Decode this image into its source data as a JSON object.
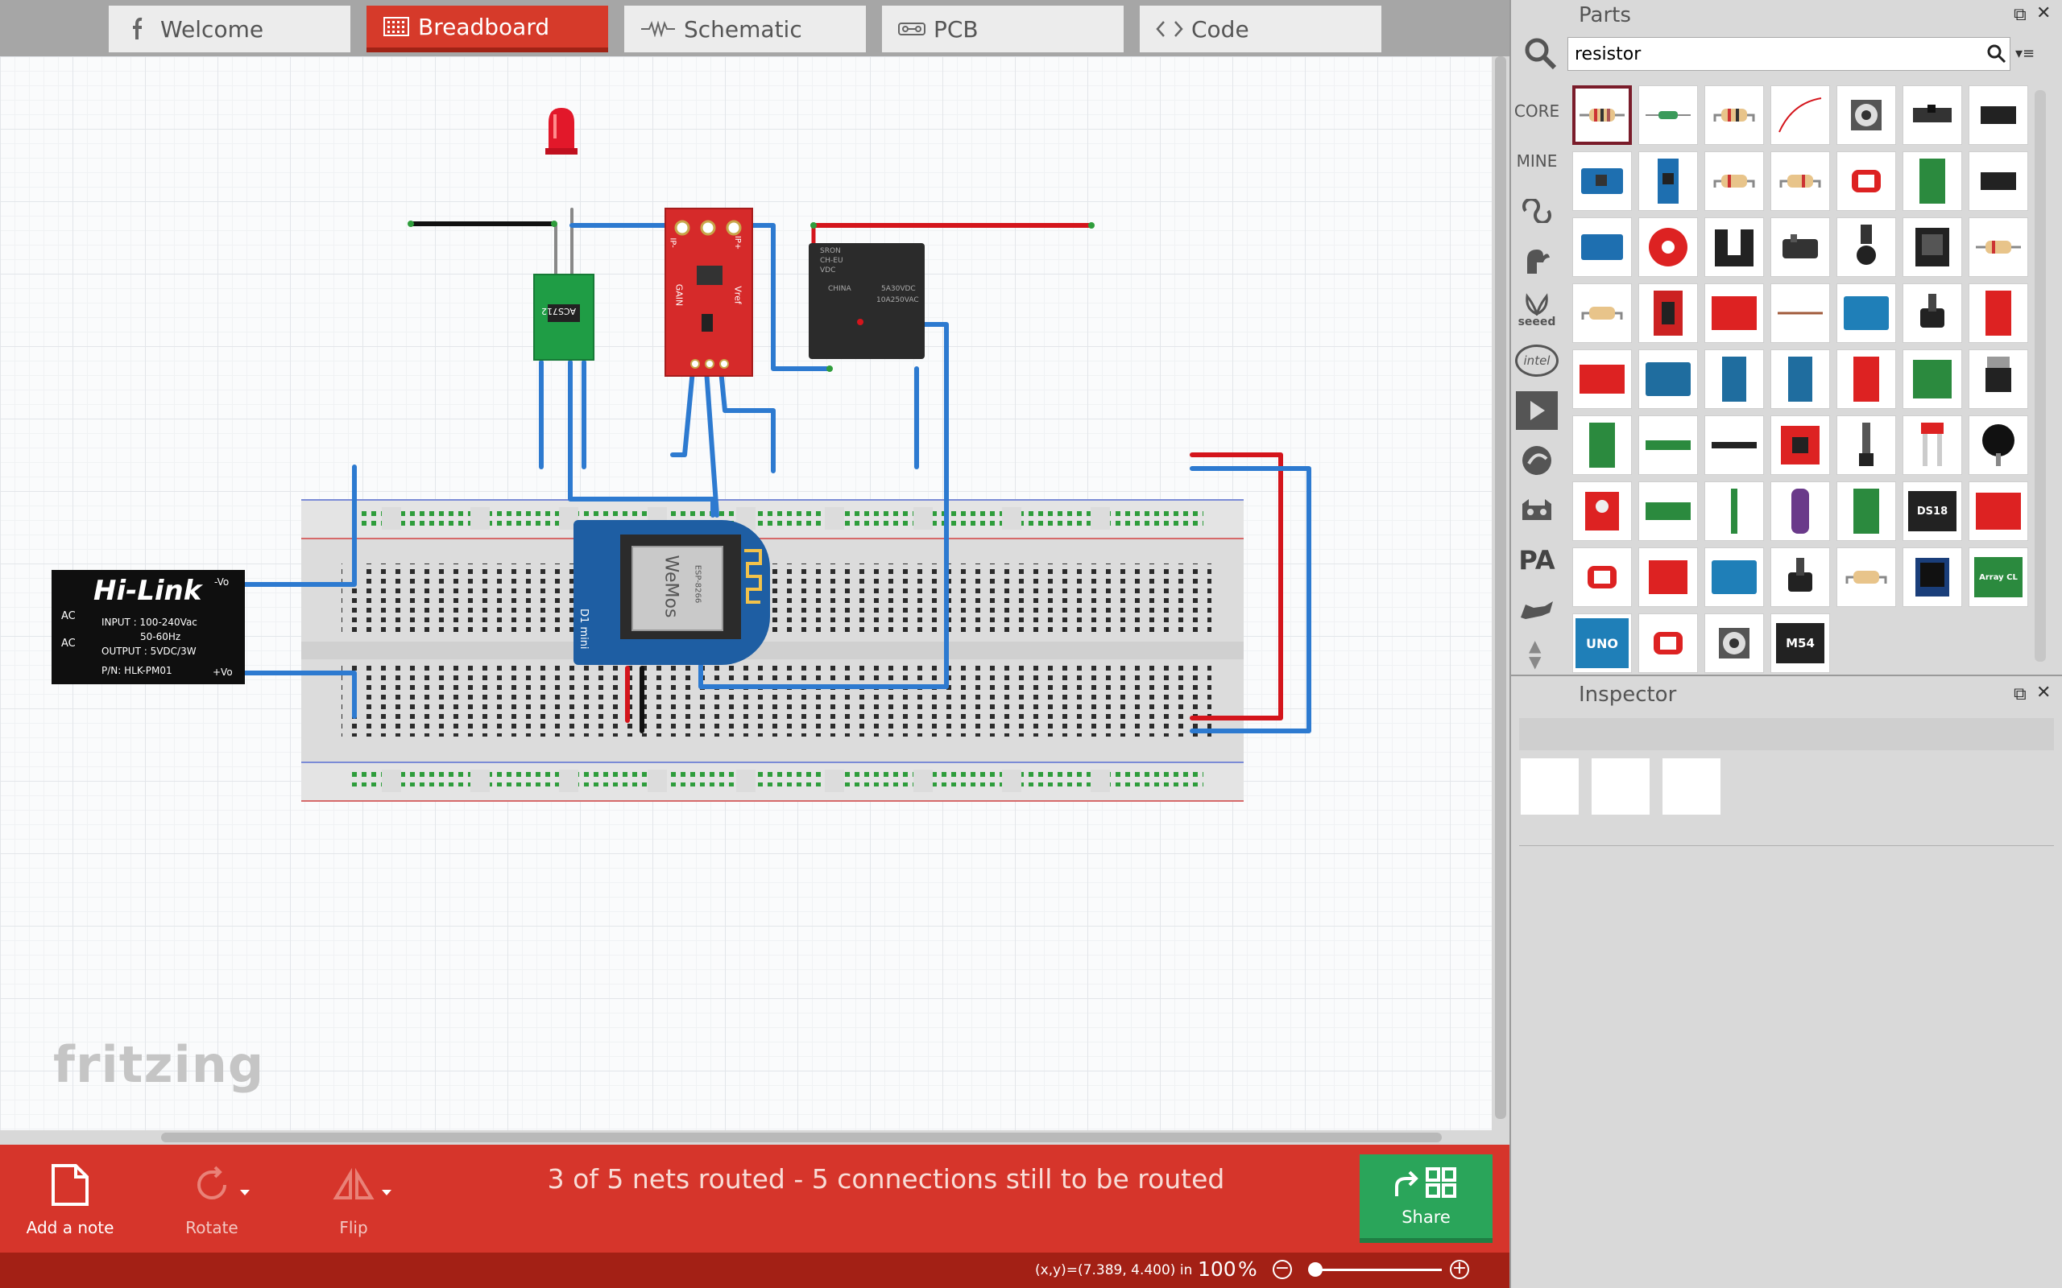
{
  "tabs": [
    {
      "label": "Welcome",
      "icon": "fritzing-f-icon",
      "active": false
    },
    {
      "label": "Breadboard",
      "icon": "breadboard-icon",
      "active": true
    },
    {
      "label": "Schematic",
      "icon": "schematic-icon",
      "active": false
    },
    {
      "label": "PCB",
      "icon": "pcb-icon",
      "active": false
    },
    {
      "label": "Code",
      "icon": "code-icon",
      "active": false
    }
  ],
  "canvas": {
    "watermark": "fritzing",
    "power_module": {
      "brand": "Hi-Link",
      "input_line1": "INPUT : 100-240Vac",
      "input_line2": "50-60Hz",
      "output": "OUTPUT : 5VDC/3W",
      "part_no": "P/N: HLK-PM01",
      "ac1": "AC",
      "ac2": "AC",
      "vo_minus": "-Vo",
      "vo_plus": "+Vo"
    },
    "current_sensor": {
      "label": "ACS712"
    },
    "amplifier": {
      "gain": "GAIN",
      "vref": "Vref",
      "ip_minus": "IP-",
      "ip_plus": "IP+"
    },
    "relay": {
      "text1": "SRON",
      "text2": "CH-EU",
      "text3": "VDC",
      "text4": "CHINA",
      "text5": "5A30VDC",
      "text6": "10A250VAC"
    },
    "d1mini": {
      "brand": "WeMos",
      "model": "D1 mini",
      "chip": "ESP-8266"
    }
  },
  "toolbar": {
    "add_note": "Add a note",
    "rotate": "Rotate",
    "flip": "Flip",
    "routing_status": "3 of 5 nets routed - 5 connections still to be routed",
    "share": "Share"
  },
  "statusbar": {
    "coords": "(x,y)=(7.389, 4.400) in",
    "zoom": "100",
    "zoom_unit": "%",
    "zoom_level": 0.0
  },
  "parts": {
    "title": "Parts",
    "search_value": "resistor",
    "bins": [
      "CORE",
      "MINE",
      "arduino-bin-icon",
      "sparkfun-bin-icon",
      "seeed",
      "intel",
      "play-bin-icon",
      "snootlab-bin-icon",
      "animal-bin-icon",
      "PA",
      "dog-bin-icon"
    ],
    "grid_texts": {
      "uno": "UNO",
      "ds18": "DS18",
      "m54": "M54",
      "array": "Array CL"
    }
  },
  "inspector": {
    "title": "Inspector"
  },
  "colors": {
    "accent": "#d6352b",
    "share": "#2aa55a",
    "wire_blue": "#2d7ad0",
    "wire_red": "#d4151c"
  }
}
